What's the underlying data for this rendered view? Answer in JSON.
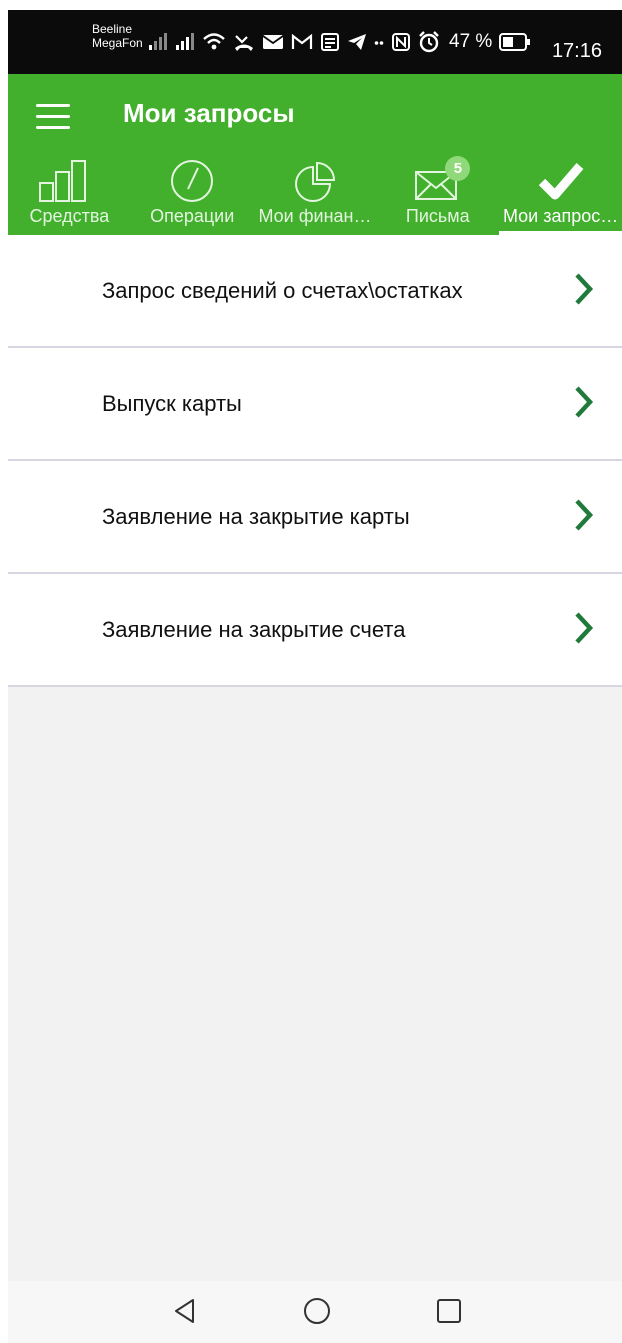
{
  "status_bar": {
    "carrier_1": "Beeline",
    "carrier_2": "MegaFon",
    "battery": "47 %",
    "time": "17:16"
  },
  "app_bar": {
    "title": "Мои запросы"
  },
  "tabs": [
    {
      "label": "Средства",
      "icon": "bar-chart-icon"
    },
    {
      "label": "Операции",
      "icon": "clock-icon"
    },
    {
      "label": "Мои финан…",
      "icon": "pie-chart-icon"
    },
    {
      "label": "Письма",
      "icon": "envelope-icon",
      "badge": "5"
    },
    {
      "label": "Мои запрос…",
      "icon": "checkmark-icon",
      "active": true
    }
  ],
  "requests": [
    {
      "label": "Запрос сведений о счетах\\остатках"
    },
    {
      "label": "Выпуск карты"
    },
    {
      "label": "Заявление на закрытие карты"
    },
    {
      "label": "Заявление на закрытие счета"
    }
  ],
  "colors": {
    "brand_green": "#42b02d",
    "chevron_green": "#1f7a3c",
    "badge_green": "#8fd97a"
  }
}
